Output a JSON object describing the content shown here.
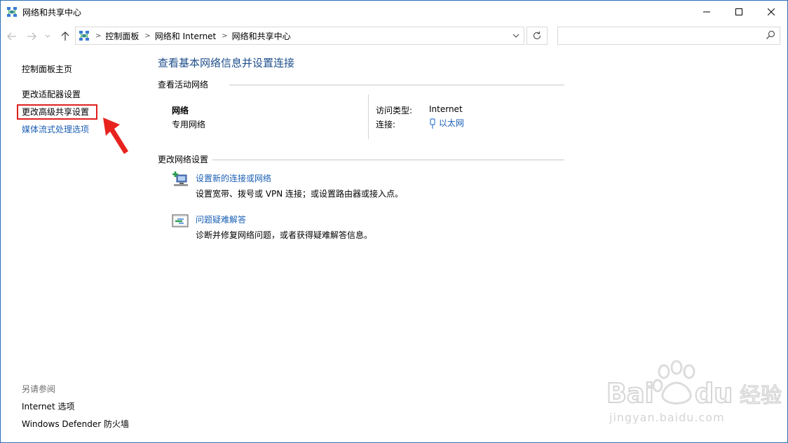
{
  "window": {
    "title": "网络和共享中心"
  },
  "breadcrumb": [
    "控制面板",
    "网络和 Internet",
    "网络和共享中心"
  ],
  "leftpane": {
    "home": "控制面板主页",
    "adapter": "更改适配器设置",
    "advanced_sharing": "更改高级共享设置",
    "media_streaming": "媒体流式处理选项",
    "see_also": "另请参阅",
    "internet_options": "Internet 选项",
    "firewall": "Windows Defender 防火墙"
  },
  "main": {
    "title": "查看基本网络信息并设置连接",
    "active_networks": "查看活动网络",
    "network_name": "网络",
    "network_type": "专用网络",
    "access_type_label": "访问类型:",
    "access_type_value": "Internet",
    "connection_label": "连接:",
    "connection_value": "以太网",
    "change_settings": "更改网络设置",
    "tasks": [
      {
        "link": "设置新的连接或网络",
        "desc": "设置宽带、拨号或 VPN 连接；或设置路由器或接入点。"
      },
      {
        "link": "问题疑难解答",
        "desc": "诊断并修复网络问题，或者获得疑难解答信息。"
      }
    ]
  },
  "watermark": {
    "text": "jingyan.baidu.com"
  },
  "colors": {
    "link": "#1a5fb4",
    "title": "#1e4e8c",
    "highlight": "#e01e1e"
  }
}
